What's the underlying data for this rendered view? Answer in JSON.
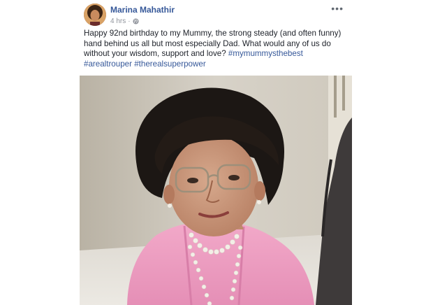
{
  "post": {
    "author_name": "Marina Mahathir",
    "timestamp": "4 hrs",
    "separator": "·",
    "privacy_icon": "globe-icon",
    "more_icon": "more-options-icon",
    "more_label": "•••",
    "text_body": "Happy 92nd birthday to my Mummy, the strong steady (and often funny) hand behind us all but most especially Dad. What would any of us do without your wisdom, support and love?",
    "hashtags": [
      "#mymummysthebest",
      "#arealtrouper",
      "#therealsuperpower"
    ]
  },
  "colors": {
    "author_link": "#365899",
    "meta_text": "#90949c",
    "body_text": "#1d2129",
    "background": "#ffffff"
  }
}
